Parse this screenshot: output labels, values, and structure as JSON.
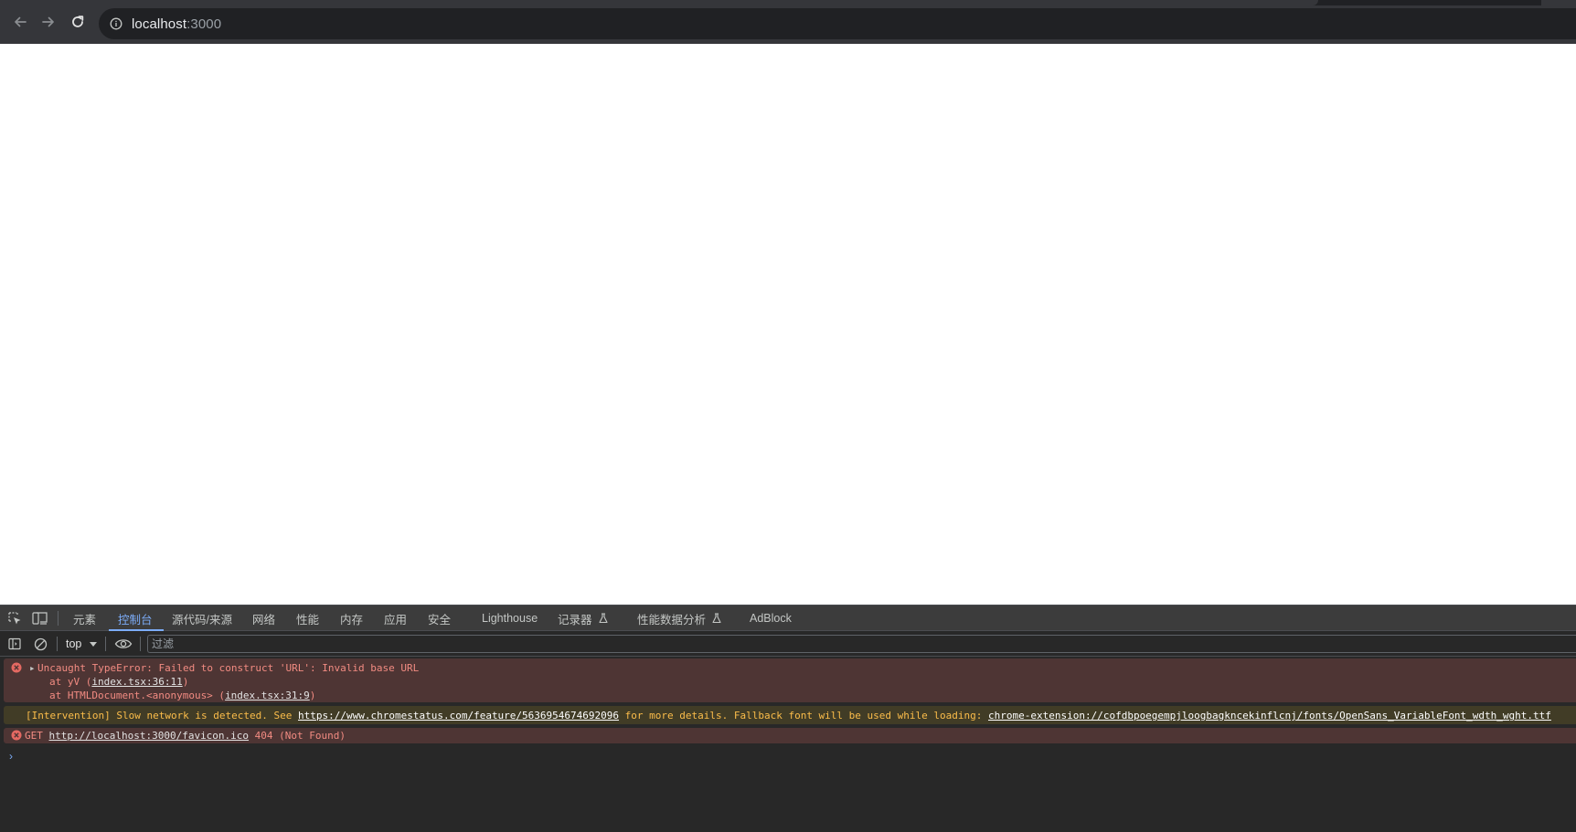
{
  "browser": {
    "url_host": "localhost",
    "url_port": ":3000"
  },
  "devtools": {
    "tabs": [
      {
        "label": "元素"
      },
      {
        "label": "控制台"
      },
      {
        "label": "源代码/来源"
      },
      {
        "label": "网络"
      },
      {
        "label": "性能"
      },
      {
        "label": "内存"
      },
      {
        "label": "应用"
      },
      {
        "label": "安全"
      },
      {
        "label": "Lighthouse"
      },
      {
        "label": "记录器"
      },
      {
        "label": "性能数据分析"
      },
      {
        "label": "AdBlock"
      }
    ],
    "active_tab": "控制台",
    "context": "top",
    "filter_placeholder": "过滤"
  },
  "console": {
    "error1": {
      "message": "Uncaught TypeError: Failed to construct 'URL': Invalid base URL",
      "stack1_prefix": "at yV (",
      "stack1_link": "index.tsx:36:11",
      "stack1_suffix": ")",
      "stack2_prefix": "at HTMLDocument.<anonymous> (",
      "stack2_link": "index.tsx:31:9",
      "stack2_suffix": ")"
    },
    "warning": {
      "text1": "[Intervention] Slow network is detected. See ",
      "link1": "https://www.chromestatus.com/feature/5636954674692096",
      "text2": " for more details. Fallback font will be used while loading: ",
      "link2": "chrome-extension://cofdbpoegempjloogbagkncekinflcnj/fonts/OpenSans_VariableFont_wdth_wght.ttf"
    },
    "error2": {
      "prefix": "GET ",
      "link": "http://localhost:3000/favicon.ico",
      "suffix": " 404 (Not Found)"
    },
    "prompt": "›"
  },
  "colors": {
    "error_bg": "#4e3534",
    "error_text": "#f28b82",
    "warning_bg": "#413c26",
    "warning_text": "#fcbd4a",
    "accent": "#7cacf8"
  }
}
